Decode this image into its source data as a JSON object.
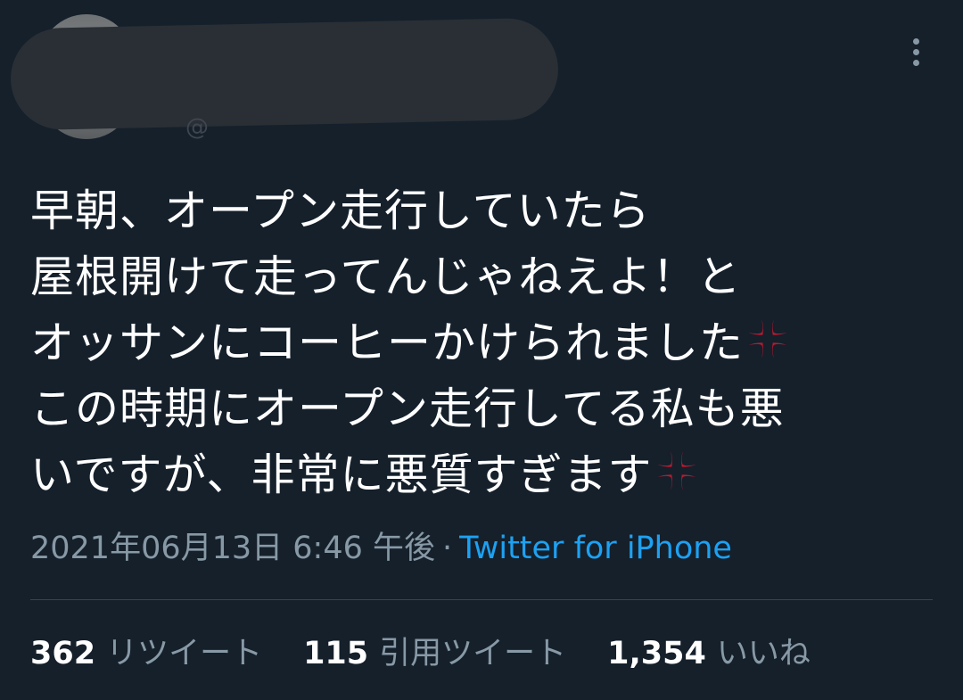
{
  "header": {
    "handle_peek": "@",
    "more_icon": "more-vertical-icon"
  },
  "tweet": {
    "lines": [
      "早朝、オープン走行していたら",
      "屋根開けて走ってんじゃねえよ！と",
      "オッサンにコーヒーかけられました",
      "この時期にオープン走行してる私も悪",
      "いですが、非常に悪質すぎます"
    ],
    "emoji": "anger-symbol-icon",
    "emoji_color": "#be1931"
  },
  "meta": {
    "timestamp": "2021年06月13日 6:46 午後",
    "separator": "·",
    "source": "Twitter for iPhone",
    "source_color": "#1da1f2"
  },
  "stats": {
    "retweets": {
      "count": "362",
      "label": "リツイート"
    },
    "quotes": {
      "count": "115",
      "label": "引用ツイート"
    },
    "likes": {
      "count": "1,354",
      "label": "いいね"
    }
  },
  "colors": {
    "background": "#15202b",
    "text": "#ffffff",
    "secondary": "#8899a6",
    "divider": "#38444d"
  }
}
